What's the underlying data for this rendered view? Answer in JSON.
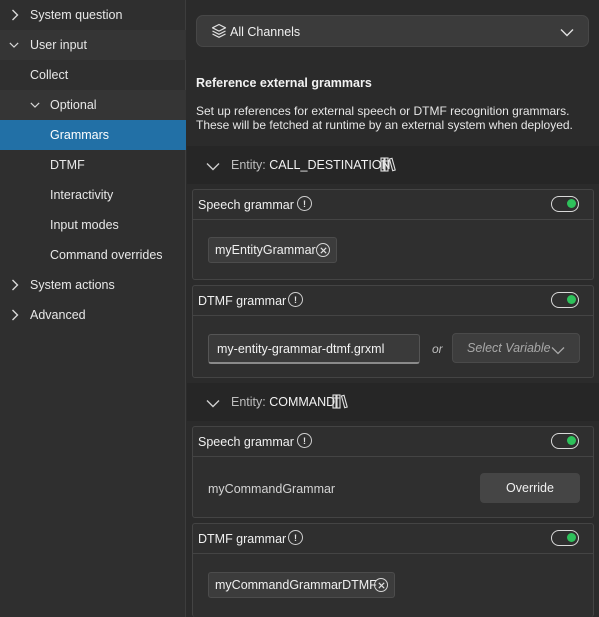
{
  "sidebar": {
    "items": [
      {
        "label": "System question",
        "chevron": "right"
      },
      {
        "label": "User input",
        "chevron": "down"
      },
      {
        "label": "Collect",
        "chevron": "none"
      },
      {
        "label": "Optional",
        "chevron": "down"
      },
      {
        "label": "Grammars",
        "chevron": "none",
        "active": true
      },
      {
        "label": "DTMF",
        "chevron": "none"
      },
      {
        "label": "Interactivity",
        "chevron": "none"
      },
      {
        "label": "Input modes",
        "chevron": "none"
      },
      {
        "label": "Command overrides",
        "chevron": "none"
      },
      {
        "label": "System actions",
        "chevron": "right"
      },
      {
        "label": "Advanced",
        "chevron": "right"
      }
    ]
  },
  "header": {
    "channel_select": {
      "value": "All Channels",
      "icon": "layers-icon"
    }
  },
  "section": {
    "title": "Reference external grammars",
    "description_line1": "Set up references for external speech or DTMF recognition grammars.",
    "description_line2": "These will be fetched at runtime by an external system when deployed."
  },
  "entities": [
    {
      "prefix": "Entity:",
      "name": "CALL_DESTINATION",
      "speech": {
        "title": "Speech grammar",
        "enabled": true,
        "chip": "myEntityGrammar"
      },
      "dtmf": {
        "title": "DTMF grammar",
        "enabled": true,
        "input_value": "my-entity-grammar-dtmf.grxml",
        "or_label": "or",
        "select_placeholder": "Select Variable"
      }
    },
    {
      "prefix": "Entity:",
      "name": "COMMAND",
      "speech": {
        "title": "Speech grammar",
        "enabled": true,
        "value": "myCommandGrammar",
        "override_label": "Override"
      },
      "dtmf": {
        "title": "DTMF grammar",
        "enabled": true,
        "chip": "myCommandGrammarDTMF"
      }
    }
  ],
  "colors": {
    "accent": "#2270a6",
    "toggle_on": "#2ec15b",
    "background": "#2b2b2b"
  }
}
